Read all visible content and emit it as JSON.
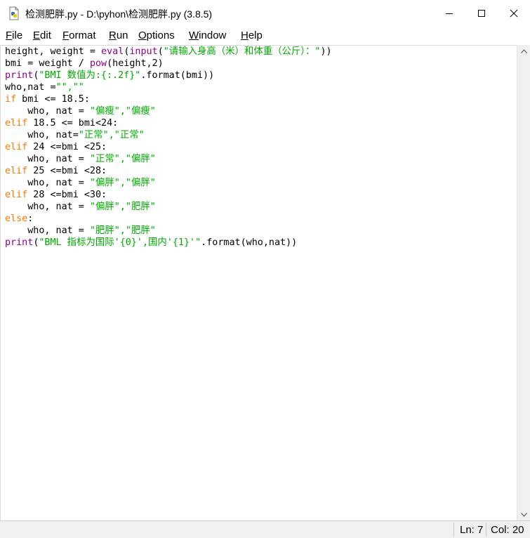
{
  "window": {
    "title": "检测肥胖.py - D:\\pyhon\\检测肥胖.py (3.8.5)",
    "icon": "python-file-icon"
  },
  "menu": [
    {
      "label": "File",
      "accel": "F",
      "rest": "ile"
    },
    {
      "label": "Edit",
      "accel": "E",
      "rest": "dit"
    },
    {
      "label": "Format",
      "accel": "F",
      "rest": "ormat"
    },
    {
      "label": "Run",
      "accel": "R",
      "rest": "un"
    },
    {
      "label": "Options",
      "accel": "O",
      "rest": "ptions"
    },
    {
      "label": "Window",
      "accel": "W",
      "rest": "indow"
    },
    {
      "label": "Help",
      "accel": "H",
      "rest": "elp"
    }
  ],
  "colors": {
    "keyword": "#ff7700",
    "builtin": "#900090",
    "string": "#00aa00",
    "default": "#000000"
  },
  "code_lines": [
    [
      [
        "df",
        "height, weight = "
      ],
      [
        "bi",
        "eval"
      ],
      [
        "df",
        "("
      ],
      [
        "bi",
        "input"
      ],
      [
        "df",
        "("
      ],
      [
        "st",
        "\"请输入身高（米）和体重（公斤）：\""
      ],
      [
        "df",
        "))"
      ]
    ],
    [
      [
        "df",
        "bmi = weight / "
      ],
      [
        "bi",
        "pow"
      ],
      [
        "df",
        "(height,2)"
      ]
    ],
    [
      [
        "bi",
        "print"
      ],
      [
        "df",
        "("
      ],
      [
        "st",
        "\"BMI 数值为:{:.2f}\""
      ],
      [
        "df",
        ".format(bmi))"
      ]
    ],
    [
      [
        "df",
        "who,nat ="
      ],
      [
        "st",
        "\"\",\"\""
      ]
    ],
    [
      [
        "kw",
        "if"
      ],
      [
        "df",
        " bmi <= 18.5:"
      ]
    ],
    [
      [
        "df",
        "    who, nat = "
      ],
      [
        "st",
        "\"偏瘦\",\"偏瘦\""
      ]
    ],
    [
      [
        "kw",
        "elif"
      ],
      [
        "df",
        " 18.5 <= bmi<24:"
      ]
    ],
    [
      [
        "df",
        "    who, nat="
      ],
      [
        "st",
        "\"正常\",\"正常\""
      ]
    ],
    [
      [
        "kw",
        "elif"
      ],
      [
        "df",
        " 24 <=bmi <25:"
      ]
    ],
    [
      [
        "df",
        "    who, nat = "
      ],
      [
        "st",
        "\"正常\",\"偏胖\""
      ]
    ],
    [
      [
        "kw",
        "elif"
      ],
      [
        "df",
        " 25 <=bmi <28:"
      ]
    ],
    [
      [
        "df",
        "    who, nat = "
      ],
      [
        "st",
        "\"偏胖\",\"偏胖\""
      ]
    ],
    [
      [
        "kw",
        "elif"
      ],
      [
        "df",
        " 28 <=bmi <30:"
      ]
    ],
    [
      [
        "df",
        "    who, nat = "
      ],
      [
        "st",
        "\"偏胖\",\"肥胖\""
      ]
    ],
    [
      [
        "kw",
        "else"
      ],
      [
        "df",
        ":"
      ]
    ],
    [
      [
        "df",
        "    who, nat = "
      ],
      [
        "st",
        "\"肥胖\",\"肥胖\""
      ]
    ],
    [
      [
        "bi",
        "print"
      ],
      [
        "df",
        "("
      ],
      [
        "st",
        "\"BML 指标为国际'{0}',国内'{1}'\""
      ],
      [
        "df",
        ".format(who,nat))"
      ]
    ]
  ],
  "status": {
    "ln": "Ln: 7",
    "col": "Col: 20"
  }
}
